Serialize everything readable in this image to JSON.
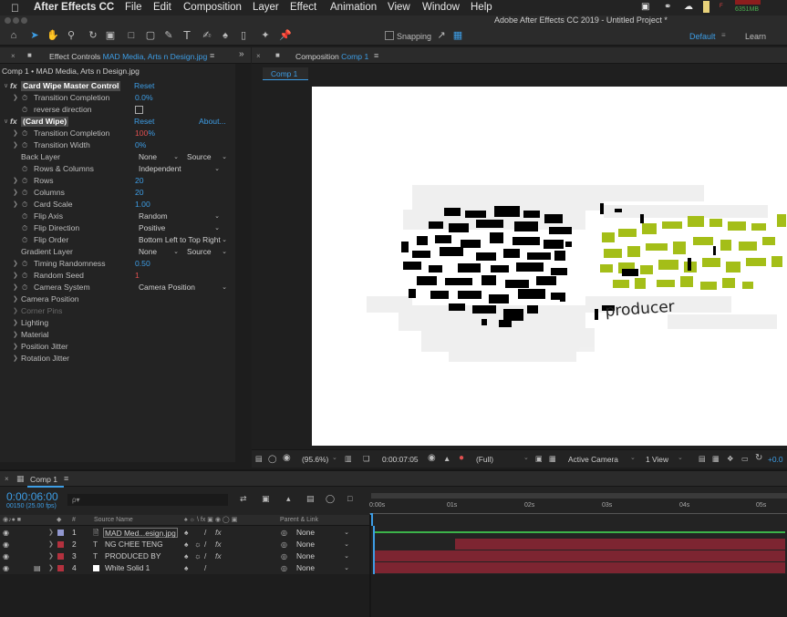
{
  "menubar": {
    "apple": "",
    "items": [
      "After Effects CC",
      "File",
      "Edit",
      "Composition",
      "Layer",
      "Effect",
      "Animation",
      "View",
      "Window",
      "Help"
    ],
    "memory": "6351MB"
  },
  "titlebar": {
    "title": "Adobe After Effects CC 2019 - Untitled Project *"
  },
  "toolbar": {
    "snapping": "Snapping",
    "workspace": "Default",
    "learn": "Learn"
  },
  "effect_controls": {
    "tab_label": "Effect Controls",
    "tab_file": "MAD Media, Arts n Design.jpg",
    "breadcrumb": "Comp 1 • MAD Media, Arts n Design.jpg",
    "master": {
      "name": "Card Wipe Master Control",
      "reset": "Reset",
      "params": [
        {
          "label": "Transition Completion",
          "value": "0.0%"
        },
        {
          "label": "reverse direction",
          "value": ""
        }
      ]
    },
    "card_wipe": {
      "name": "(Card Wipe)",
      "reset": "Reset",
      "about": "About...",
      "params": [
        {
          "label": "Transition Completion",
          "value": "100",
          "unit": "%"
        },
        {
          "label": "Transition Width",
          "value": "0%"
        },
        {
          "label": "Back Layer",
          "value": "None",
          "value2": "Source"
        },
        {
          "label": "Rows & Columns",
          "value": "Independent"
        },
        {
          "label": "Rows",
          "value": "20"
        },
        {
          "label": "Columns",
          "value": "20"
        },
        {
          "label": "Card Scale",
          "value": "1.00"
        },
        {
          "label": "Flip Axis",
          "value": "Random"
        },
        {
          "label": "Flip Direction",
          "value": "Positive"
        },
        {
          "label": "Flip Order",
          "value": "Bottom Left to Top Right"
        },
        {
          "label": "Gradient Layer",
          "value": "None",
          "value2": "Source"
        },
        {
          "label": "Timing Randomness",
          "value": "0.50"
        },
        {
          "label": "Random Seed",
          "value": "1"
        },
        {
          "label": "Camera System",
          "value": "Camera Position"
        },
        {
          "label": "Camera Position",
          "value": ""
        },
        {
          "label": "Corner Pins",
          "value": ""
        },
        {
          "label": "Lighting",
          "value": ""
        },
        {
          "label": "Material",
          "value": ""
        },
        {
          "label": "Position Jitter",
          "value": ""
        },
        {
          "label": "Rotation Jitter",
          "value": ""
        }
      ]
    }
  },
  "composition": {
    "tab_label": "Composition",
    "tab_comp": "Comp 1",
    "subtab": "Comp 1",
    "canvas_text": "producer",
    "zoom": "(95.6%)",
    "timecode": "0:00:07:05",
    "resolution": "(Full)",
    "camera": "Active Camera",
    "view": "1 View",
    "exposure": "+0.0"
  },
  "timeline": {
    "tab": "Comp 1",
    "current_time": "0:00:06:00",
    "frame_info": "00150 (25.00 fps)",
    "search_placeholder": "ρ▾",
    "col_num": "#",
    "col_source": "Source Name",
    "col_parent": "Parent & Link",
    "ruler": [
      "0:00s",
      "01s",
      "02s",
      "03s",
      "04s",
      "05s"
    ],
    "layers": [
      {
        "num": "1",
        "type": "img",
        "name": "MAD Med...esign.jpg",
        "parent": "None",
        "color": "#9298d0",
        "bar_start": 0.0,
        "bar_end": 1.0,
        "bar": "green"
      },
      {
        "num": "2",
        "type": "T",
        "name": "NG CHEE TENG",
        "parent": "None",
        "color": "#b3313e",
        "bar_start": 0.2,
        "bar_end": 1.0,
        "bar": "red"
      },
      {
        "num": "3",
        "type": "T",
        "name": "PRODUCED BY",
        "parent": "None",
        "color": "#b3313e",
        "bar_start": 0.0,
        "bar_end": 1.0,
        "bar": "red"
      },
      {
        "num": "4",
        "type": "solid",
        "name": "White Solid 1",
        "parent": "None",
        "color": "#b3313e",
        "bar_start": 0.0,
        "bar_end": 1.0,
        "bar": "red"
      }
    ]
  },
  "colors": {
    "accent": "#3d9de5",
    "canvas_green": "#a4be18",
    "red_value": "#e05050",
    "layer_bar": "#7d2531"
  }
}
